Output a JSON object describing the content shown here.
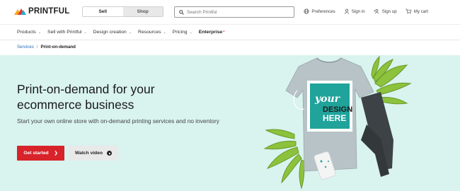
{
  "brand": {
    "name": "PRINTFUL",
    "accent": "#d8232a"
  },
  "mode_switch": {
    "sell_label": "Sell",
    "shop_label": "Shop"
  },
  "search": {
    "placeholder": "Search Printful"
  },
  "top_links": [
    {
      "label": "Preferences",
      "icon": "globe-icon"
    },
    {
      "label": "Sign in",
      "icon": "user-icon"
    },
    {
      "label": "Sign up",
      "icon": "user-plus-icon"
    },
    {
      "label": "My cart",
      "icon": "cart-icon"
    }
  ],
  "nav": [
    {
      "label": "Products"
    },
    {
      "label": "Sell with Printful"
    },
    {
      "label": "Design creation"
    },
    {
      "label": "Resources"
    },
    {
      "label": "Pricing"
    },
    {
      "label": "Enterprise",
      "badge": "*"
    }
  ],
  "breadcrumb": {
    "parent": "Services",
    "separator": "/",
    "current": "Print-on-demand"
  },
  "hero": {
    "title": "Print-on-demand for your ecommerce business",
    "subtitle": "Start your own online store with on-demand printing services and no inventory",
    "primary_cta": "Get started",
    "secondary_cta": "Watch video",
    "shirt_text_line1": "your",
    "shirt_text_line2": "DESIGN",
    "shirt_text_line3": "HERE",
    "background_color": "#d9f3ef"
  }
}
